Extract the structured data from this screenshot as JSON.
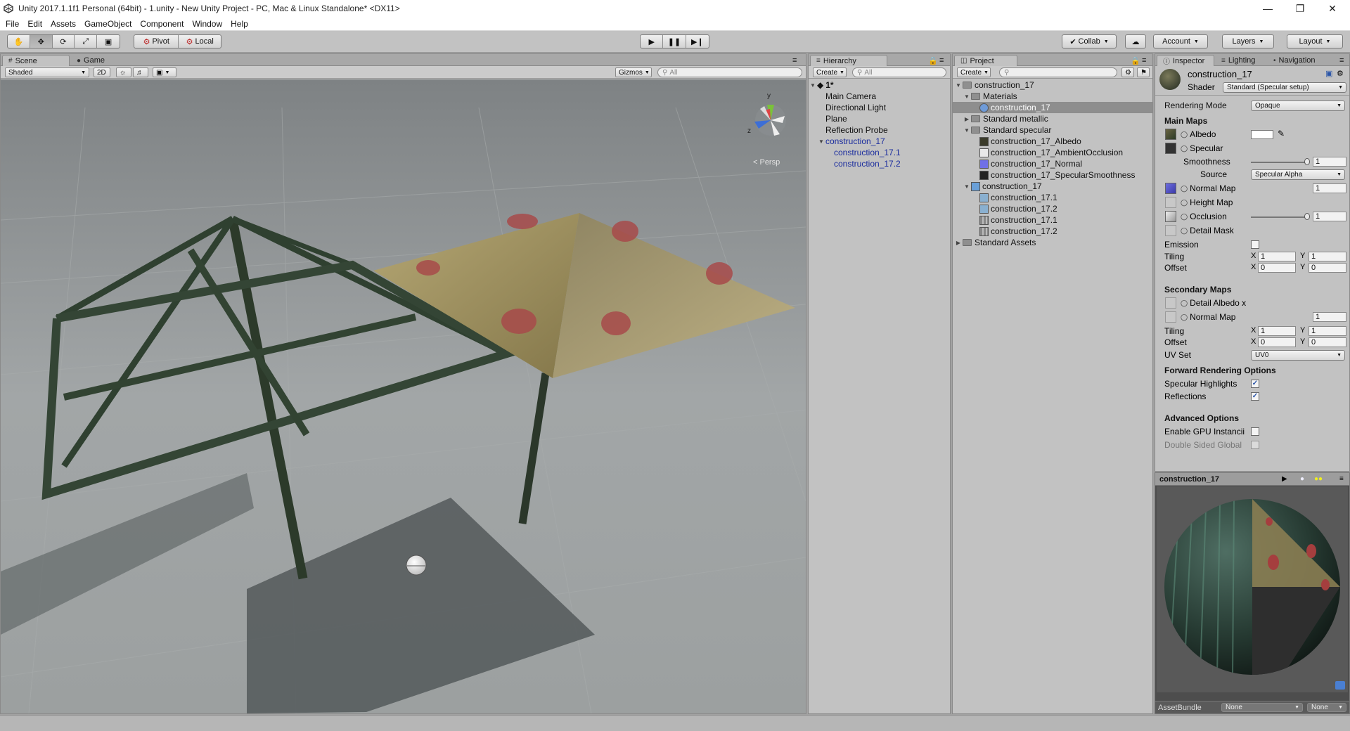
{
  "window": {
    "title": "Unity 2017.1.1f1 Personal (64bit) - 1.unity - New Unity Project - PC, Mac & Linux Standalone* <DX11>"
  },
  "menu": [
    "File",
    "Edit",
    "Assets",
    "GameObject",
    "Component",
    "Window",
    "Help"
  ],
  "toolbar": {
    "pivot": "Pivot",
    "local": "Local",
    "collab": "Collab",
    "account": "Account",
    "layers": "Layers",
    "layout": "Layout"
  },
  "scene": {
    "tab_scene": "Scene",
    "tab_game": "Game",
    "shading": "Shaded",
    "mode2d": "2D",
    "gizmos": "Gizmos",
    "search": "All",
    "persp": "< Persp"
  },
  "hierarchy": {
    "tab": "Hierarchy",
    "create": "Create",
    "search": "All",
    "scene_name": "1*",
    "items": [
      {
        "label": "Main Camera",
        "depth": 1,
        "blue": false
      },
      {
        "label": "Directional Light",
        "depth": 1,
        "blue": false
      },
      {
        "label": "Plane",
        "depth": 1,
        "blue": false
      },
      {
        "label": "Reflection Probe",
        "depth": 1,
        "blue": false
      },
      {
        "label": "construction_17",
        "depth": 1,
        "blue": true
      },
      {
        "label": "construction_17.1",
        "depth": 2,
        "blue": true
      },
      {
        "label": "construction_17.2",
        "depth": 2,
        "blue": true
      }
    ]
  },
  "project": {
    "tab": "Project",
    "create": "Create",
    "items": [
      {
        "label": "construction_17",
        "kind": "folder"
      },
      {
        "label": "Materials",
        "kind": "folder"
      },
      {
        "label": "construction_17",
        "kind": "material"
      },
      {
        "label": "Standard metallic",
        "kind": "folder"
      },
      {
        "label": "Standard specular",
        "kind": "folder"
      },
      {
        "label": "construction_17_Albedo",
        "kind": "texture"
      },
      {
        "label": "construction_17_AmbientOcclusion",
        "kind": "texture"
      },
      {
        "label": "construction_17_Normal",
        "kind": "texture"
      },
      {
        "label": "construction_17_SpecularSmoothness",
        "kind": "texture"
      },
      {
        "label": "construction_17",
        "kind": "prefab"
      },
      {
        "label": "construction_17.1",
        "kind": "mesh"
      },
      {
        "label": "construction_17.2",
        "kind": "mesh"
      },
      {
        "label": "construction_17.1",
        "kind": "grid"
      },
      {
        "label": "construction_17.2",
        "kind": "grid"
      },
      {
        "label": "Standard Assets",
        "kind": "folder"
      }
    ]
  },
  "inspector": {
    "tab_inspector": "Inspector",
    "tab_lighting": "Lighting",
    "tab_navigation": "Navigation",
    "material_name": "construction_17",
    "shader_label": "Shader",
    "shader_value": "Standard (Specular setup)",
    "rendering_mode_label": "Rendering Mode",
    "rendering_mode_value": "Opaque",
    "main_maps": "Main Maps",
    "albedo": "Albedo",
    "specular": "Specular",
    "smoothness": "Smoothness",
    "smoothness_value": "1",
    "source": "Source",
    "source_value": "Specular Alpha",
    "normal_map": "Normal Map",
    "normal_value": "1",
    "height_map": "Height Map",
    "occlusion": "Occlusion",
    "occlusion_value": "1",
    "detail_mask": "Detail Mask",
    "emission": "Emission",
    "tiling": "Tiling",
    "offset": "Offset",
    "x": "X",
    "y": "Y",
    "tiling_x": "1",
    "tiling_y": "1",
    "offset_x": "0",
    "offset_y": "0",
    "secondary_maps": "Secondary Maps",
    "detail_albedo": "Detail Albedo x",
    "normal_map2": "Normal Map",
    "normal2_value": "1",
    "tiling2_x": "1",
    "tiling2_y": "1",
    "offset2_x": "0",
    "offset2_y": "0",
    "uv_set": "UV Set",
    "uv_set_value": "UV0",
    "forward_rendering": "Forward Rendering Options",
    "specular_highlights": "Specular Highlights",
    "reflections": "Reflections",
    "advanced": "Advanced Options",
    "gpu_instancing": "Enable GPU Instancii",
    "double_sided": "Double Sided Global",
    "preview_title": "construction_17",
    "asset_bundle": "AssetBundle",
    "bundle_value": "None",
    "bundle_variant": "None"
  }
}
